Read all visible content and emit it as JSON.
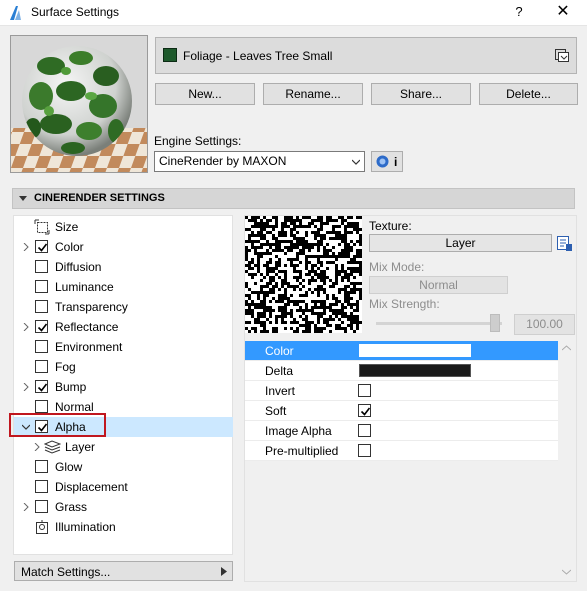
{
  "window": {
    "title": "Surface Settings",
    "help": "?",
    "close": "✕"
  },
  "material": {
    "name": "Foliage - Leaves Tree Small",
    "swatch_color": "#1e5a2c"
  },
  "buttons": {
    "new": "New...",
    "rename": "Rename...",
    "share": "Share...",
    "delete": "Delete..."
  },
  "engine": {
    "label": "Engine Settings:",
    "value": "CineRender by MAXON",
    "info": "i"
  },
  "section": {
    "title": "CINERENDER SETTINGS"
  },
  "channels": [
    {
      "label": "Size",
      "icon": "size-icon"
    },
    {
      "label": "Color",
      "checked": true,
      "expandable": true
    },
    {
      "label": "Diffusion",
      "checked": false
    },
    {
      "label": "Luminance",
      "checked": false
    },
    {
      "label": "Transparency",
      "checked": false
    },
    {
      "label": "Reflectance",
      "checked": true,
      "expandable": true
    },
    {
      "label": "Environment",
      "checked": false
    },
    {
      "label": "Fog",
      "checked": false
    },
    {
      "label": "Bump",
      "checked": true,
      "expandable": true
    },
    {
      "label": "Normal",
      "checked": false
    },
    {
      "label": "Alpha",
      "checked": true,
      "expanded": true,
      "selected": true
    },
    {
      "label": "Layer",
      "icon": "layer-icon",
      "child": true
    },
    {
      "label": "Glow",
      "checked": false
    },
    {
      "label": "Displacement",
      "checked": false
    },
    {
      "label": "Grass",
      "checked": false,
      "expandable": true
    },
    {
      "label": "Illumination",
      "icon": "illumination-icon"
    }
  ],
  "match_settings": "Match Settings...",
  "texture": {
    "label": "Texture:",
    "value": "Layer",
    "mix_mode_label": "Mix Mode:",
    "mix_mode_value": "Normal",
    "mix_strength_label": "Mix Strength:",
    "mix_strength_value": "100.00"
  },
  "properties": [
    {
      "name": "Color",
      "type": "color",
      "value": "#ffffff",
      "selected": true
    },
    {
      "name": "Delta",
      "type": "color",
      "value": "#1a1a1a"
    },
    {
      "name": "Invert",
      "type": "checkbox",
      "checked": false
    },
    {
      "name": "Soft",
      "type": "checkbox",
      "checked": true
    },
    {
      "name": "Image Alpha",
      "type": "checkbox",
      "checked": false
    },
    {
      "name": "Pre-multiplied",
      "type": "checkbox",
      "checked": false
    }
  ],
  "colors": {
    "selection_blue": "#3399ff",
    "tree_selection": "#cce8ff",
    "highlight_red": "#c0171f"
  }
}
